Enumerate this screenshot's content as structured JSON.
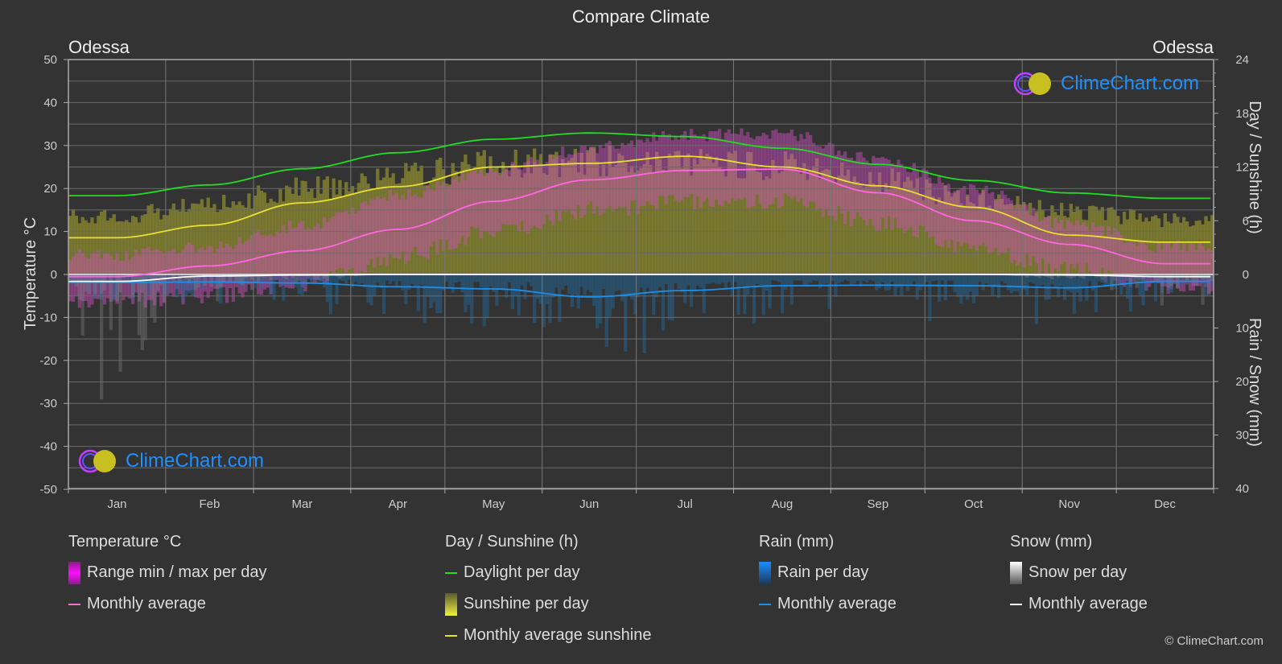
{
  "title": "Compare Climate",
  "location_left": "Odessa",
  "location_right": "Odessa",
  "watermark": "ClimeChart.com",
  "copyright": "© ClimeChart.com",
  "colors": {
    "background": "#333333",
    "daylight": "#22dd22",
    "sunshine_avg": "#e8e030",
    "temp_avg": "#ff66e0",
    "rain_avg": "#1e8fe8",
    "snow_avg": "#ffffff",
    "temp_range": "#e000e0",
    "sunshine_fill": "#9a9a30",
    "rain_fill": "#1e6aa0",
    "snow_fill": "#888888",
    "watermark_text": "#1e90ff"
  },
  "legend": {
    "temperature": {
      "heading": "Temperature °C",
      "items": [
        "Range min / max per day",
        "Monthly average"
      ]
    },
    "sunshine": {
      "heading": "Day / Sunshine (h)",
      "items": [
        "Daylight per day",
        "Sunshine per day",
        "Monthly average sunshine"
      ]
    },
    "rain": {
      "heading": "Rain (mm)",
      "items": [
        "Rain per day",
        "Monthly average"
      ]
    },
    "snow": {
      "heading": "Snow (mm)",
      "items": [
        "Snow per day",
        "Monthly average"
      ]
    }
  },
  "chart_data": {
    "type": "line",
    "title": "Compare Climate",
    "categories": [
      "Jan",
      "Feb",
      "Mar",
      "Apr",
      "May",
      "Jun",
      "Jul",
      "Aug",
      "Sep",
      "Oct",
      "Nov",
      "Dec"
    ],
    "y_left": {
      "label": "Temperature °C",
      "range": [
        -50,
        50
      ],
      "ticks": [
        "50",
        "40",
        "30",
        "20",
        "10",
        "0",
        "-10",
        "-20",
        "-30",
        "-40",
        "-50"
      ]
    },
    "y_right_top": {
      "label": "Day / Sunshine (h)",
      "range": [
        0,
        24
      ],
      "ticks": [
        "24",
        "18",
        "12",
        "6",
        "0"
      ]
    },
    "y_right_bottom": {
      "label": "Rain / Snow (mm)",
      "range": [
        0,
        40
      ],
      "ticks": [
        "0",
        "10",
        "20",
        "30",
        "40"
      ]
    },
    "grid": true,
    "series": [
      {
        "name": "Daylight per day",
        "axis": "hours",
        "values": [
          8.8,
          10.0,
          11.8,
          13.6,
          15.1,
          15.8,
          15.4,
          14.1,
          12.3,
          10.5,
          9.1,
          8.5
        ]
      },
      {
        "name": "Monthly average sunshine",
        "axis": "hours",
        "values": [
          4.1,
          5.5,
          8.0,
          9.8,
          12.0,
          12.4,
          13.2,
          12.0,
          9.9,
          7.5,
          4.4,
          3.6
        ]
      },
      {
        "name": "Temperature monthly average",
        "axis": "temperature",
        "values": [
          -0.5,
          2.0,
          5.5,
          10.5,
          17.0,
          22.0,
          24.2,
          24.5,
          19.0,
          12.5,
          7.0,
          2.5
        ]
      },
      {
        "name": "Rain monthly average",
        "axis": "mm",
        "values": [
          1.5,
          1.4,
          1.6,
          2.3,
          2.7,
          4.2,
          3.0,
          2.1,
          2.0,
          2.1,
          2.5,
          1.3
        ]
      },
      {
        "name": "Snow monthly average",
        "axis": "mm",
        "values": [
          1.3,
          0.3,
          0.1,
          0.0,
          0.0,
          0.0,
          0.0,
          0.0,
          0.0,
          0.0,
          0.1,
          0.4
        ]
      }
    ],
    "temperature_range_daily_approx": {
      "min": [
        -4,
        -3,
        0,
        6,
        12,
        17,
        19,
        19,
        14,
        8,
        3,
        -1
      ],
      "max": [
        3,
        5,
        10,
        17,
        23,
        28,
        31,
        31,
        25,
        18,
        10,
        5
      ]
    },
    "sunshine_daily_max_approx": [
      7.5,
      9.0,
      11.0,
      12.5,
      14.0,
      14.5,
      14.5,
      14.0,
      12.0,
      9.5,
      8.0,
      7.0
    ],
    "legend_position": "bottom"
  }
}
